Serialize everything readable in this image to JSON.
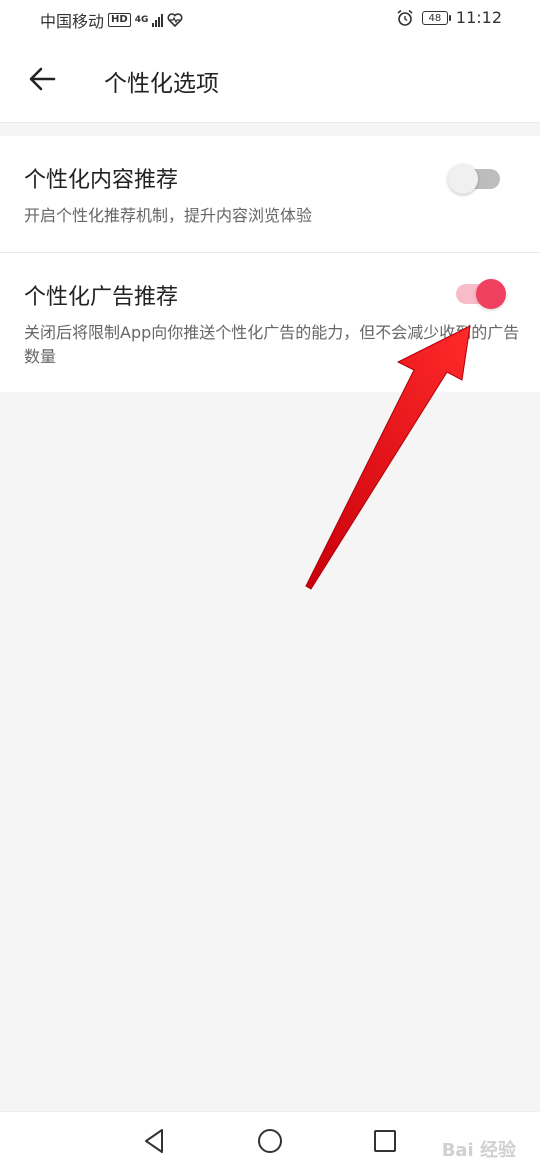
{
  "status_bar": {
    "carrier": "中国移动",
    "hd": "HD",
    "network": "4G",
    "battery": "48",
    "time": "11:12"
  },
  "header": {
    "title": "个性化选项"
  },
  "settings": [
    {
      "title": "个性化内容推荐",
      "description": "开启个性化推荐机制，提升内容浏览体验",
      "enabled": false
    },
    {
      "title": "个性化广告推荐",
      "description": "关闭后将限制App向你推送个性化广告的能力，但不会减少收到的广告数量",
      "enabled": true
    }
  ],
  "colors": {
    "toggle_on_track": "#f7bcc8",
    "toggle_on_knob": "#f04060",
    "toggle_off_track": "#bdbdbd",
    "annotation_arrow": "#e8101e"
  },
  "watermark": "Bai 经验"
}
